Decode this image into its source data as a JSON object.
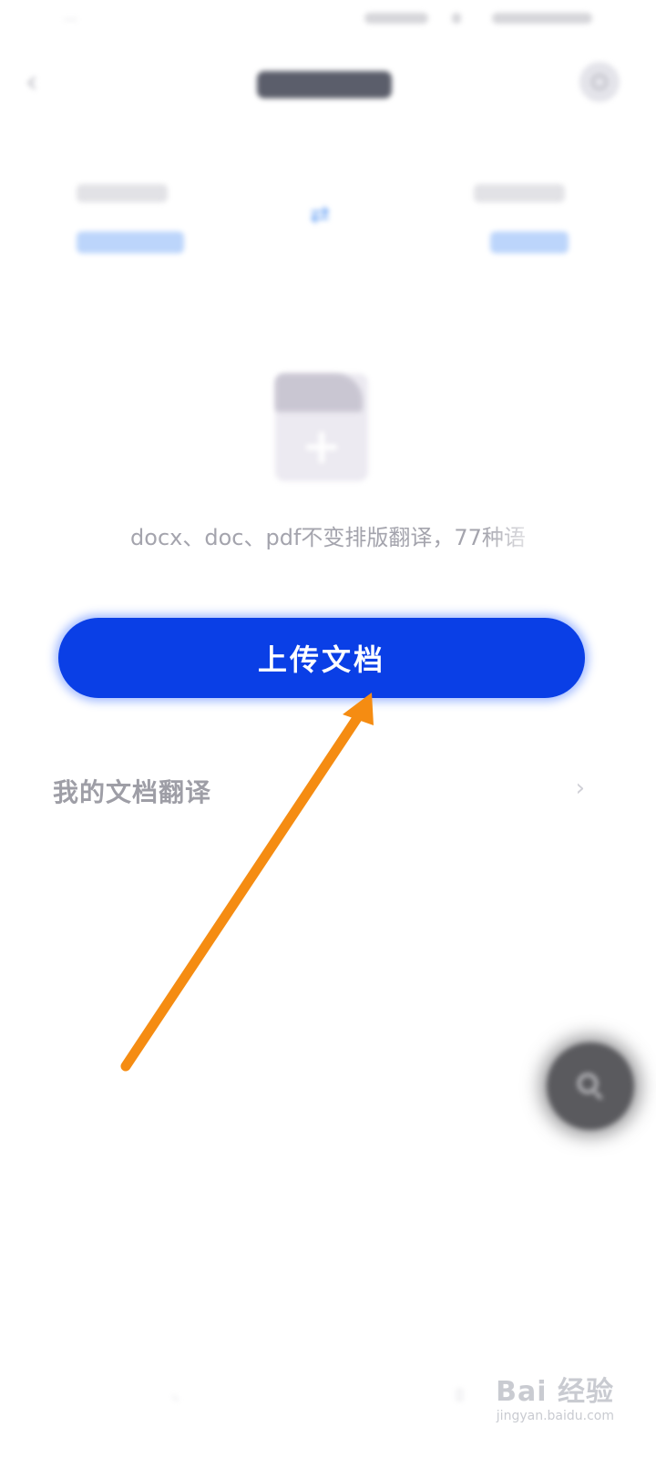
{
  "status_bar": {
    "left_text": "···",
    "right_text": ""
  },
  "header": {
    "title": "",
    "back_icon": "chevron-left-icon",
    "settings_icon": "gear-icon"
  },
  "languages": {
    "source_caption": "",
    "source_value": "",
    "target_caption": "",
    "target_value": "",
    "swap_icon": "swap-icon"
  },
  "upload_area": {
    "file_icon": "file-plus-icon",
    "formats_text": "docx、doc、pdf不变排版翻译，77种语"
  },
  "actions": {
    "upload_label": "上传文档"
  },
  "my_docs": {
    "label": "我的文档翻译",
    "chevron": "›"
  },
  "fab": {
    "icon": "search-icon"
  },
  "watermark": {
    "main": "Bai 经验",
    "sub": "jingyan.baidu.com"
  },
  "colors": {
    "primary": "#0a3fe6",
    "link_blue": "#6aa3f5",
    "annotation_arrow": "#f58c12"
  }
}
